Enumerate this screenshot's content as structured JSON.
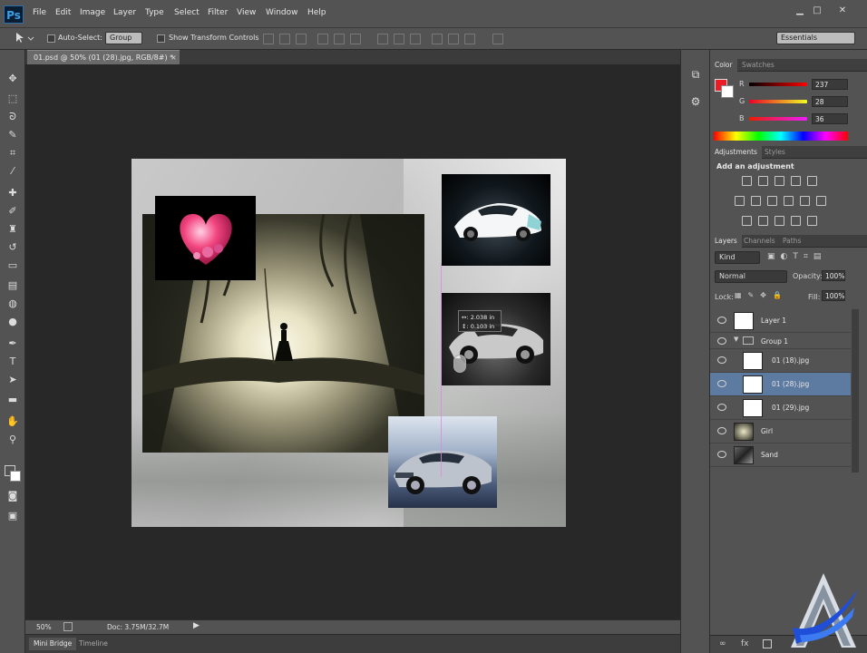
{
  "app": {
    "logo": "Ps"
  },
  "menu": [
    "File",
    "Edit",
    "Image",
    "Layer",
    "Type",
    "Select",
    "Filter",
    "View",
    "Window",
    "Help"
  ],
  "window_controls": {
    "minimize": "▁",
    "maximize": "□",
    "close": "✕"
  },
  "options_bar": {
    "auto_select_label": "Auto-Select:",
    "auto_select_value": "Group",
    "show_transform_label": "Show Transform Controls",
    "workspace": "Essentials"
  },
  "document": {
    "tab_title": "01.psd @ 50% (01 (28).jpg, RGB/8#) *",
    "zoom": "50%",
    "doc_size": "Doc: 3.75M/32.7M",
    "measure_w": "↔: 2.038 in",
    "measure_h": "↕: 0.103 in"
  },
  "bottom_tabs": [
    "Mini Bridge",
    "Timeline"
  ],
  "color_panel": {
    "tabs": [
      "Color",
      "Swatches"
    ],
    "r_label": "R",
    "g_label": "G",
    "b_label": "B",
    "r": "237",
    "g": "28",
    "b": "36",
    "foreground": "#ed1c24"
  },
  "adjustments_panel": {
    "tabs": [
      "Adjustments",
      "Styles"
    ],
    "heading": "Add an adjustment"
  },
  "layers_panel": {
    "tabs": [
      "Layers",
      "Channels",
      "Paths"
    ],
    "filter_kind": "Kind",
    "blend_mode": "Normal",
    "opacity_label": "Opacity:",
    "opacity": "100%",
    "lock_label": "Lock:",
    "fill_label": "Fill:",
    "fill": "100%",
    "layers": [
      {
        "name": "Layer 1"
      },
      {
        "name": "Group 1"
      },
      {
        "name": "01 (18).jpg"
      },
      {
        "name": "01 (28).jpg"
      },
      {
        "name": "01 (29).jpg"
      },
      {
        "name": "Girl"
      },
      {
        "name": "Sand"
      }
    ],
    "selected_index": 3
  }
}
